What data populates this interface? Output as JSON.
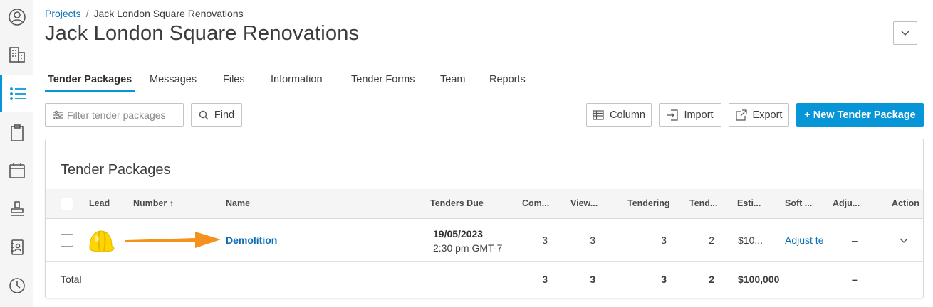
{
  "breadcrumb": {
    "projects": "Projects",
    "separator": "/",
    "current": "Jack London Square Renovations"
  },
  "page_title": "Jack London Square Renovations",
  "sidebar": {
    "items": [
      {
        "icon": "user-icon"
      },
      {
        "icon": "building-icon"
      },
      {
        "icon": "list-icon",
        "active": true
      },
      {
        "icon": "clipboard-icon"
      },
      {
        "icon": "calendar-icon"
      },
      {
        "icon": "stamp-icon"
      },
      {
        "icon": "address-book-icon"
      },
      {
        "icon": "clock-icon"
      }
    ]
  },
  "tabs": [
    "Tender Packages",
    "Messages",
    "Files",
    "Information",
    "Tender Forms",
    "Team",
    "Reports"
  ],
  "toolbar": {
    "filter_placeholder": "Filter tender packages",
    "find_label": "Find",
    "column_label": "Column",
    "import_label": "Import",
    "export_label": "Export",
    "new_package_label": "+ New Tender Package"
  },
  "table": {
    "title": "Tender Packages",
    "headers": [
      "Lead",
      "Number ↑",
      "Name",
      "Tenders Due",
      "Com...",
      "View...",
      "Tendering",
      "Tend...",
      "Esti...",
      "Soft ...",
      "Adju...",
      "Action"
    ],
    "rows": [
      {
        "name": "Demolition",
        "due_date": "19/05/2023",
        "due_time": "2:30 pm GMT-7",
        "committed": "3",
        "viewed": "3",
        "tendering": "3",
        "tendered": "2",
        "estimate": "$10...",
        "soft": "Adjust te",
        "adjusted": "–"
      }
    ],
    "total": {
      "label": "Total",
      "committed": "3",
      "viewed": "3",
      "tendering": "3",
      "tendered": "2",
      "estimate": "$100,000",
      "adjusted": "–"
    }
  },
  "colors": {
    "accent": "#0696d7",
    "link": "#0a6db5",
    "arrow": "#f5921e",
    "helmet": "#ffd400"
  }
}
